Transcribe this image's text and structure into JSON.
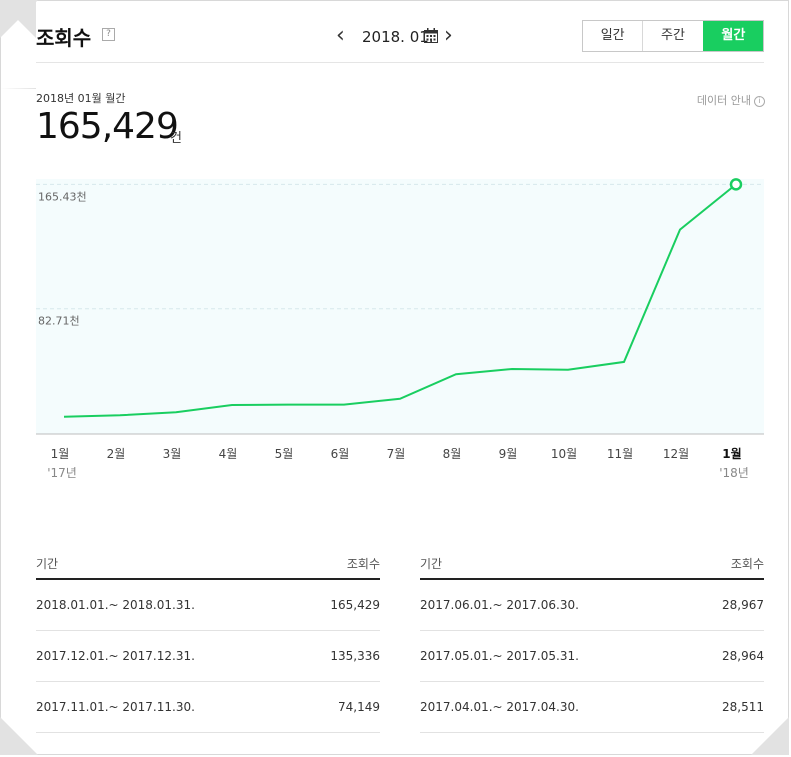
{
  "header": {
    "title": "조회수",
    "help_label": "?",
    "date": "2018. 01.",
    "tabs": [
      "일간",
      "주간",
      "월간"
    ],
    "active_tab": "월간"
  },
  "summary": {
    "period_label": "2018년 01월 월간",
    "total": "165,429",
    "unit": "건",
    "data_info": "데이터 안내",
    "info_icon_label": "i"
  },
  "colors": {
    "accent": "#19ce60",
    "chart_fill": "#f4fcfd"
  },
  "chart_data": {
    "type": "line",
    "categories": [
      "1월",
      "2월",
      "3월",
      "4월",
      "5월",
      "6월",
      "7월",
      "8월",
      "9월",
      "10월",
      "11월",
      "12월",
      "1월"
    ],
    "year_labels": {
      "0": "'17년",
      "12": "'18년"
    },
    "series": [
      {
        "values": [
          10800,
          11800,
          13800,
          18600,
          18900,
          18900,
          22800,
          39100,
          42600,
          42100,
          47300,
          135336,
          165429
        ]
      }
    ],
    "y_ticks": [
      {
        "value": 82710,
        "label": "82.71천"
      },
      {
        "value": 165430,
        "label": "165.43천"
      }
    ],
    "ylim": [
      0,
      165430
    ],
    "highlight_index": 12
  },
  "table_left": {
    "headers": [
      "기간",
      "조회수"
    ],
    "rows": [
      [
        "2018.01.01.~ 2018.01.31.",
        "165,429"
      ],
      [
        "2017.12.01.~ 2017.12.31.",
        "135,336"
      ],
      [
        "2017.11.01.~ 2017.11.30.",
        "74,149"
      ]
    ]
  },
  "table_right": {
    "headers": [
      "기간",
      "조회수"
    ],
    "rows": [
      [
        "2017.06.01.~ 2017.06.30.",
        "28,967"
      ],
      [
        "2017.05.01.~ 2017.05.31.",
        "28,964"
      ],
      [
        "2017.04.01.~ 2017.04.30.",
        "28,511"
      ]
    ]
  }
}
